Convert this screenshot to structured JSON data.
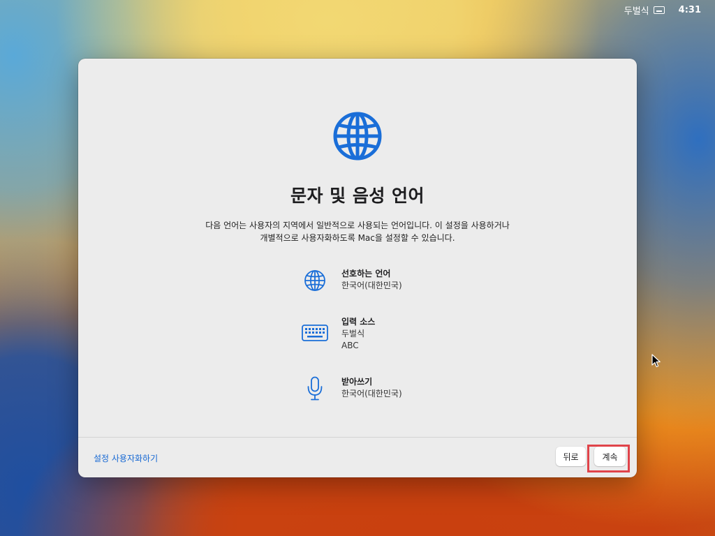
{
  "menubar": {
    "input_source": "두벌식",
    "input_source_icon": "keyboard-icon",
    "clock": "4:31"
  },
  "dialog": {
    "hero_icon": "globe-icon",
    "title": "문자 및 음성 언어",
    "description_line1": "다음 언어는 사용자의 지역에서 일반적으로 사용되는 언어입니다. 이 설정을 사용하거나",
    "description_line2": "개별적으로 사용자화하도록 Mac을 설정할 수 있습니다.",
    "items": [
      {
        "icon": "globe-icon",
        "label": "선호하는 언어",
        "values": [
          "한국어(대한민국)"
        ]
      },
      {
        "icon": "keyboard-icon",
        "label": "입력 소스",
        "values": [
          "두벌식",
          "ABC"
        ]
      },
      {
        "icon": "microphone-icon",
        "label": "받아쓰기",
        "values": [
          "한국어(대한민국)"
        ]
      }
    ],
    "customize_link": "설정 사용자화하기",
    "back_button": "뒤로",
    "continue_button": "계속"
  },
  "colors": {
    "accent": "#1668d3",
    "highlight": "#e0444a"
  }
}
